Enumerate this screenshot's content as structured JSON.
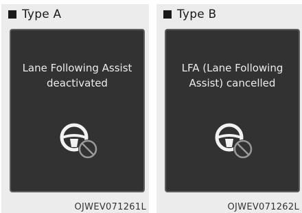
{
  "panels": [
    {
      "type_label": "Type A",
      "message": "Lane Following Assist\ndeactivated",
      "icon": "steering-wheel-prohibited-icon",
      "code": "OJWEV071261L"
    },
    {
      "type_label": "Type B",
      "message": "LFA (Lane Following\nAssist) cancelled",
      "icon": "steering-wheel-prohibited-icon",
      "code": "OJWEV071262L"
    }
  ],
  "colors": {
    "screen_bg": "#323232",
    "screen_text": "#ececec",
    "panel_bg": "#ececec",
    "icon_slash": "#9a9a9a"
  }
}
